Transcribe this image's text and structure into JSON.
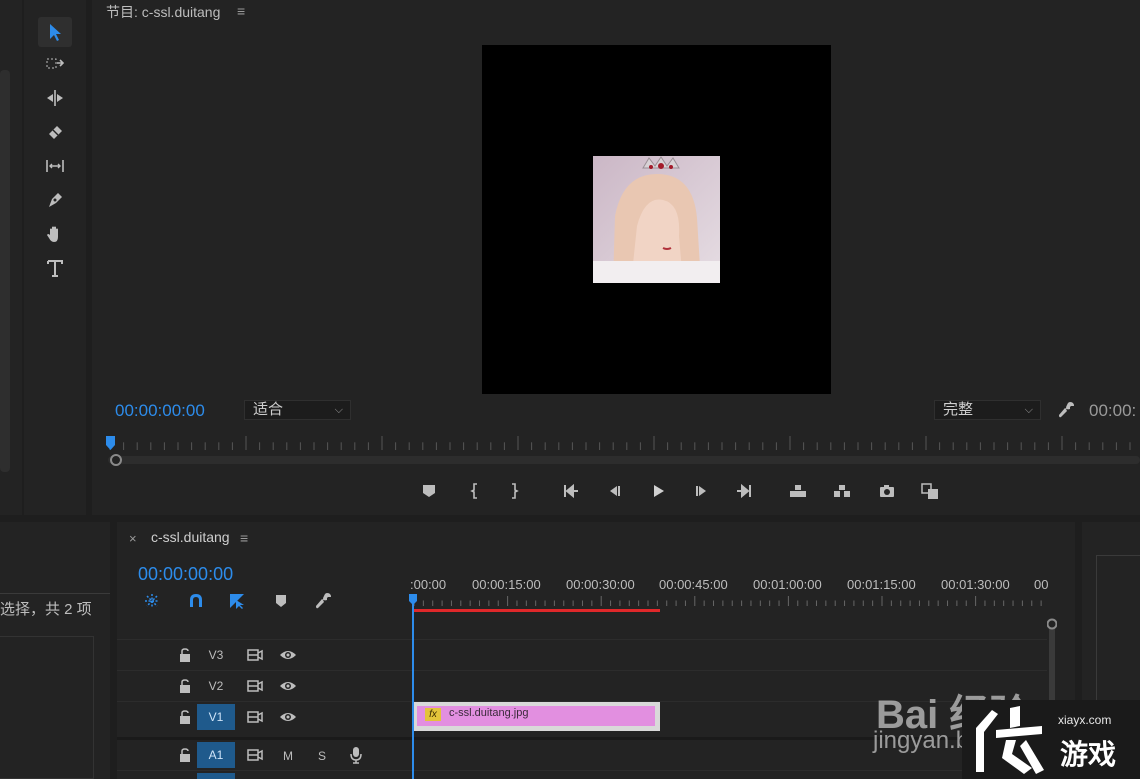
{
  "program_monitor": {
    "title": "节目: c-ssl.duitang",
    "menu_glyph": "≡",
    "timecode": "00:00:00:00",
    "fit_select": "适合",
    "quality_select": "完整",
    "timecode_right": "00:00:"
  },
  "project_panel": {
    "status": "选择，共 2 项"
  },
  "timeline": {
    "close_glyph": "×",
    "title": "c-ssl.duitang",
    "menu_glyph": "≡",
    "timecode": "00:00:00:00",
    "ruler_labels": [
      ":00:00",
      "00:00:15:00",
      "00:00:30:00",
      "00:00:45:00",
      "00:01:00:00",
      "00:01:15:00",
      "00:01:30:00",
      "00"
    ],
    "tracks": {
      "v3": "V3",
      "v2": "V2",
      "v1": "V1",
      "a1": "A1",
      "a1_mute": "M",
      "a1_solo": "S"
    },
    "clip_name": "c-ssl.duitang.jpg",
    "fx": "fx"
  },
  "watermark": {
    "baidu": "Bai 经验",
    "jingyan": "jingyan.baidu.com",
    "site_url": "xiayx.com",
    "site_name": "游戏"
  },
  "colors": {
    "accent": "#2d8ceb",
    "clip": "#e28fe0",
    "in_out": "#e0282a",
    "panel": "#232323"
  }
}
